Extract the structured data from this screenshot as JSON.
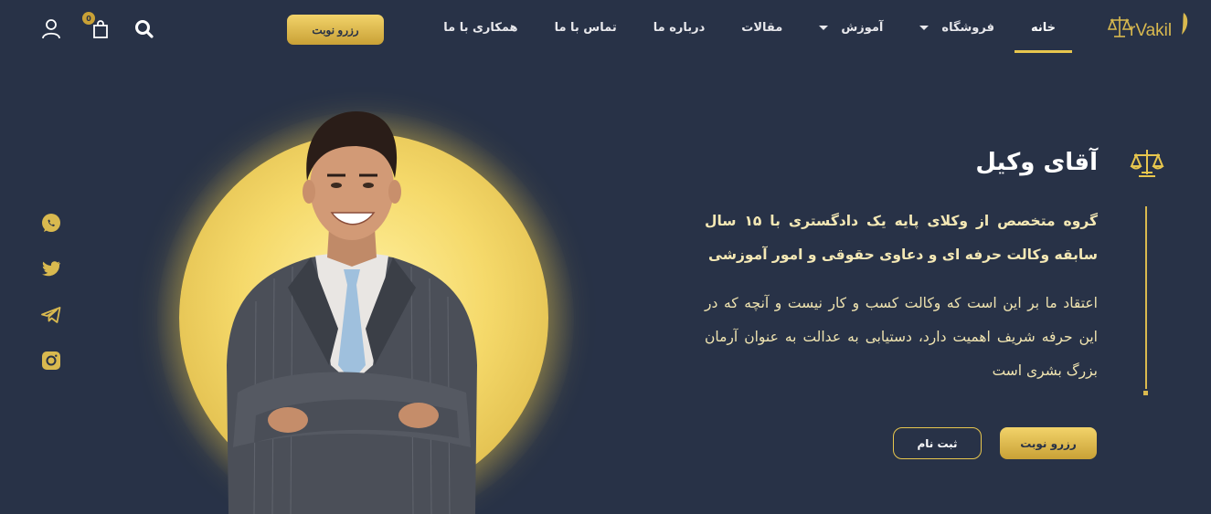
{
  "header": {
    "logo_text": "MrVakil",
    "nav": [
      {
        "label": "خانه",
        "active": true,
        "dropdown": false
      },
      {
        "label": "فروشگاه",
        "active": false,
        "dropdown": true
      },
      {
        "label": "آموزش",
        "active": false,
        "dropdown": true
      },
      {
        "label": "مقالات",
        "active": false,
        "dropdown": false
      },
      {
        "label": "درباره ما",
        "active": false,
        "dropdown": false
      },
      {
        "label": "تماس با ما",
        "active": false,
        "dropdown": false
      },
      {
        "label": "همکاری با ما",
        "active": false,
        "dropdown": false
      }
    ],
    "reserve_button": "رزرو نوبت",
    "cart_count": "0",
    "icons": [
      "search-icon",
      "cart-icon",
      "user-icon"
    ]
  },
  "hero": {
    "title": "آقای وکیل",
    "paragraph1": "گروه متخصص از وکلای پایه یک دادگستری با ۱۵ سال سابقه وکالت حرفه ای و دعاوی حقوقی و امور آموزشی",
    "paragraph2": "اعتقاد ما بر این است که وکالت کسب و کار نیست و آنچه که در این حرفه شریف اهمیت دارد، دستیابی به عدالت به عنوان آرمان بزرگ بشری است",
    "primary_button": "رزرو نوبت",
    "secondary_button": "ثبت نام"
  },
  "social": [
    "whatsapp-icon",
    "twitter-icon",
    "telegram-icon",
    "instagram-icon"
  ],
  "colors": {
    "background": "#283247",
    "gold": "#e7c64e",
    "gold_dark": "#c9a136"
  }
}
